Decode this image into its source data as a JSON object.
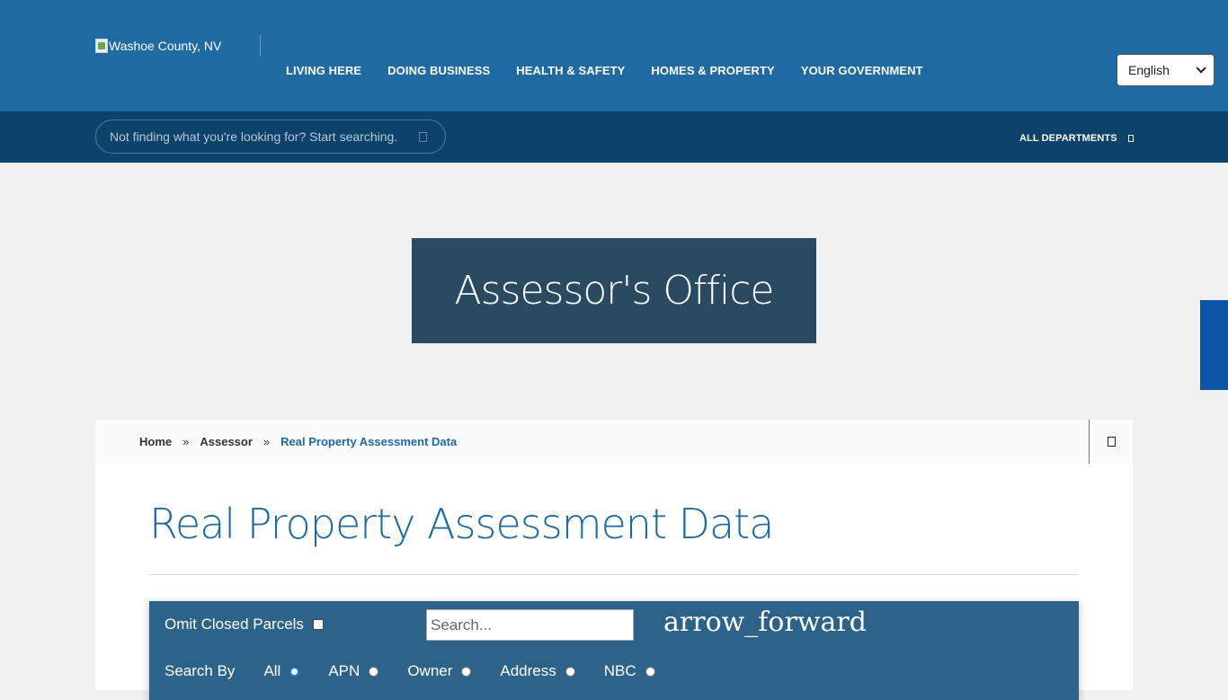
{
  "header": {
    "logo_alt": "Washoe County, NV",
    "nav": [
      "LIVING HERE",
      "DOING BUSINESS",
      "HEALTH & SAFETY",
      "HOMES & PROPERTY",
      "YOUR GOVERNMENT"
    ],
    "language": "English"
  },
  "subheader": {
    "search_placeholder": "Not finding what you're looking for? Start searching.",
    "all_departments": "ALL DEPARTMENTS"
  },
  "hero": {
    "title": "Assessor's Office"
  },
  "breadcrumb": {
    "items": [
      "Home",
      "Assessor",
      "Real Property Assessment Data"
    ],
    "separator": "»"
  },
  "page": {
    "title": "Real Property Assessment Data"
  },
  "search_panel": {
    "omit_closed_label": "Omit Closed Parcels",
    "omit_closed_checked": false,
    "search_placeholder": "Search...",
    "submit_icon_text": "arrow_forward",
    "search_by_label": "Search By",
    "options": [
      "All",
      "APN",
      "Owner",
      "Address",
      "NBC"
    ],
    "selected": "All"
  },
  "colors": {
    "header_blue": "#1f6aa1",
    "subheader_navy": "#0d426b",
    "hero_bg": "#2a4a62",
    "panel_bg": "#2d6389"
  }
}
